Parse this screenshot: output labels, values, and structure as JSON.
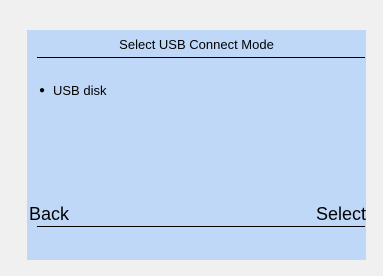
{
  "screen": {
    "title": "Select USB Connect Mode",
    "items": [
      {
        "label": "USB disk",
        "bullet": "●"
      }
    ]
  },
  "softkeys": {
    "left": "Back",
    "right": "Select"
  },
  "colors": {
    "background": "#f0f0f0",
    "screen": "#c0d8f8",
    "text": "#000000"
  }
}
